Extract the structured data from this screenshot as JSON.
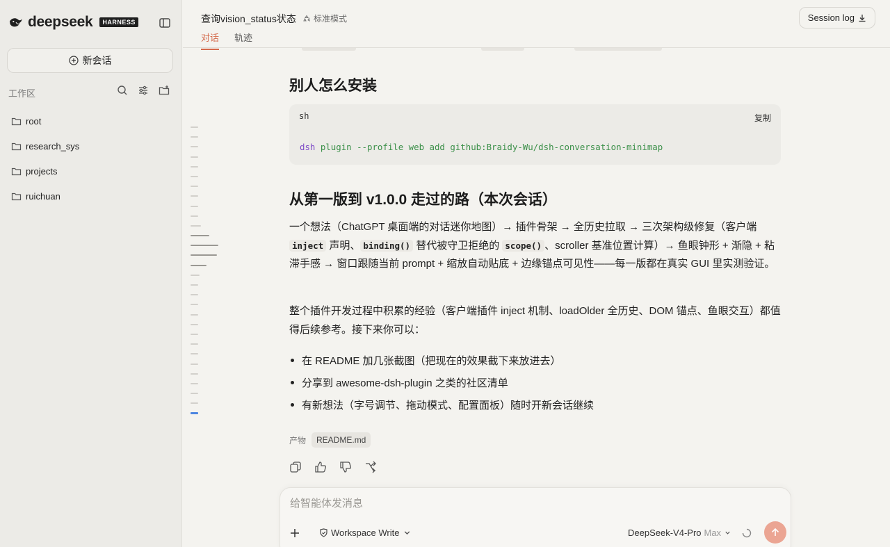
{
  "brand": {
    "name": "deepseek",
    "badge": "HARNESS"
  },
  "sidebar": {
    "new_chat_label": "新会话",
    "workspace_label": "工作区",
    "folders": [
      {
        "label": "root"
      },
      {
        "label": "research_sys"
      },
      {
        "label": "projects"
      },
      {
        "label": "ruichuan"
      }
    ]
  },
  "header": {
    "title": "查询vision_status状态",
    "mode": "标准模式",
    "tabs": [
      {
        "label": "对话",
        "active": true
      },
      {
        "label": "轨迹",
        "active": false
      }
    ],
    "session_log_label": "Session log"
  },
  "content": {
    "heading_install": "别人怎么安装",
    "code": {
      "lang": "sh",
      "copy_label": "复制",
      "cmd": "dsh",
      "args": "plugin --profile web add github:Braidy-Wu/dsh-conversation-minimap"
    },
    "heading_journey": "从第一版到 v1.0.0 走过的路（本次会话）",
    "para1": {
      "t1": "一个想法（ChatGPT 桌面端的对话迷你地图）→ 插件骨架 → 全历史拉取 → 三次架构级修复（客户端 ",
      "c1": "inject",
      "t2": " 声明、",
      "c2": "binding()",
      "t3": " 替代被守卫拒绝的 ",
      "c3": "scope()",
      "t4": "、scroller 基准位置计算）→ 鱼眼钟形 + 渐隐 + 粘滞手感 → 窗口跟随当前 prompt + 缩放自动贴底 + 边缘锚点可见性——每一版都在真实 GUI 里实测验证。"
    },
    "para2": "整个插件开发过程中积累的经验（客户端插件 inject 机制、loadOlder 全历史、DOM 锚点、鱼眼交互）都值得后续参考。接下来你可以：",
    "bullets": [
      "在 README 加几张截图（把现在的效果截下来放进去）",
      "分享到 awesome-dsh-plugin 之类的社区清单",
      "有新想法（字号调节、拖动模式、配置面板）随时开新会话继续"
    ],
    "artifact_label": "产物",
    "artifact_file": "README.md"
  },
  "composer": {
    "placeholder": "给智能体发消息",
    "workspace_mode": "Workspace Write",
    "model": "DeepSeek-V4-Pro",
    "model_tier": "Max"
  },
  "colors": {
    "accent": "#d46a4c",
    "send_button": "#eba593",
    "minimap_active": "#4c85e0"
  }
}
